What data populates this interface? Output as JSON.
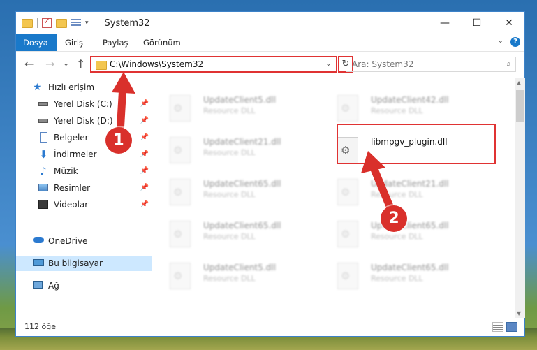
{
  "window": {
    "title": "System32"
  },
  "window_controls": {
    "minimize": "—",
    "maximize": "☐",
    "close": "✕"
  },
  "ribbon": {
    "tabs": [
      {
        "label": "Dosya",
        "active": true
      },
      {
        "label": "Giriş"
      },
      {
        "label": "Paylaş"
      },
      {
        "label": "Görünüm"
      }
    ],
    "expand_icon": "chevron-down-icon",
    "help": "?"
  },
  "nav": {
    "back": "←",
    "forward": "→",
    "recent": "⌄",
    "up": "↑"
  },
  "address": {
    "path": "C:\\Windows\\System32",
    "dropdown": "⌄",
    "refresh": "↻"
  },
  "search": {
    "placeholder": "Ara: System32",
    "icon": "⌕"
  },
  "sidebar": {
    "items": [
      {
        "label": "Hızlı erişim",
        "icon": "star-icon",
        "pinned": false
      },
      {
        "label": "Yerel Disk (C:)",
        "icon": "drive-icon",
        "pinned": true
      },
      {
        "label": "Yerel Disk (D:)",
        "icon": "drive-icon",
        "pinned": true
      },
      {
        "label": "Belgeler",
        "icon": "documents-icon",
        "pinned": true
      },
      {
        "label": "İndirmeler",
        "icon": "download-icon",
        "pinned": true
      },
      {
        "label": "Müzik",
        "icon": "music-icon",
        "pinned": true
      },
      {
        "label": "Resimler",
        "icon": "pictures-icon",
        "pinned": true
      },
      {
        "label": "Videolar",
        "icon": "videos-icon",
        "pinned": true
      },
      {
        "label": "OneDrive",
        "icon": "cloud-icon",
        "pinned": false
      },
      {
        "label": "Bu bilgisayar",
        "icon": "computer-icon",
        "pinned": false,
        "selected": true
      },
      {
        "label": "Ağ",
        "icon": "network-icon",
        "pinned": false
      }
    ]
  },
  "files": [
    {
      "name": "UpdateClient5.dll",
      "type": "Resource DLL"
    },
    {
      "name": "UpdateClient42.dll",
      "type": "Resource DLL"
    },
    {
      "name": "UpdateClient21.dll",
      "type": "Resource DLL"
    },
    {
      "name": "libmpgv_plugin.dll",
      "type": ""
    },
    {
      "name": "UpdateClient65.dll",
      "type": "Resource DLL"
    },
    {
      "name": "UpdateClient21.dll",
      "type": "Resource DLL"
    },
    {
      "name": "UpdateClient65.dll",
      "type": "Resource DLL"
    },
    {
      "name": "UpdateClient65.dll",
      "type": "Resource DLL"
    },
    {
      "name": "UpdateClient5.dll",
      "type": "Resource DLL"
    },
    {
      "name": "UpdateClient65.dll",
      "type": "Resource DLL"
    }
  ],
  "status": {
    "item_count": "112 öğe"
  },
  "callouts": [
    "1",
    "2"
  ],
  "colors": {
    "accent": "#1979ca",
    "highlight": "#e03333",
    "selected_bg": "#cde8ff"
  }
}
